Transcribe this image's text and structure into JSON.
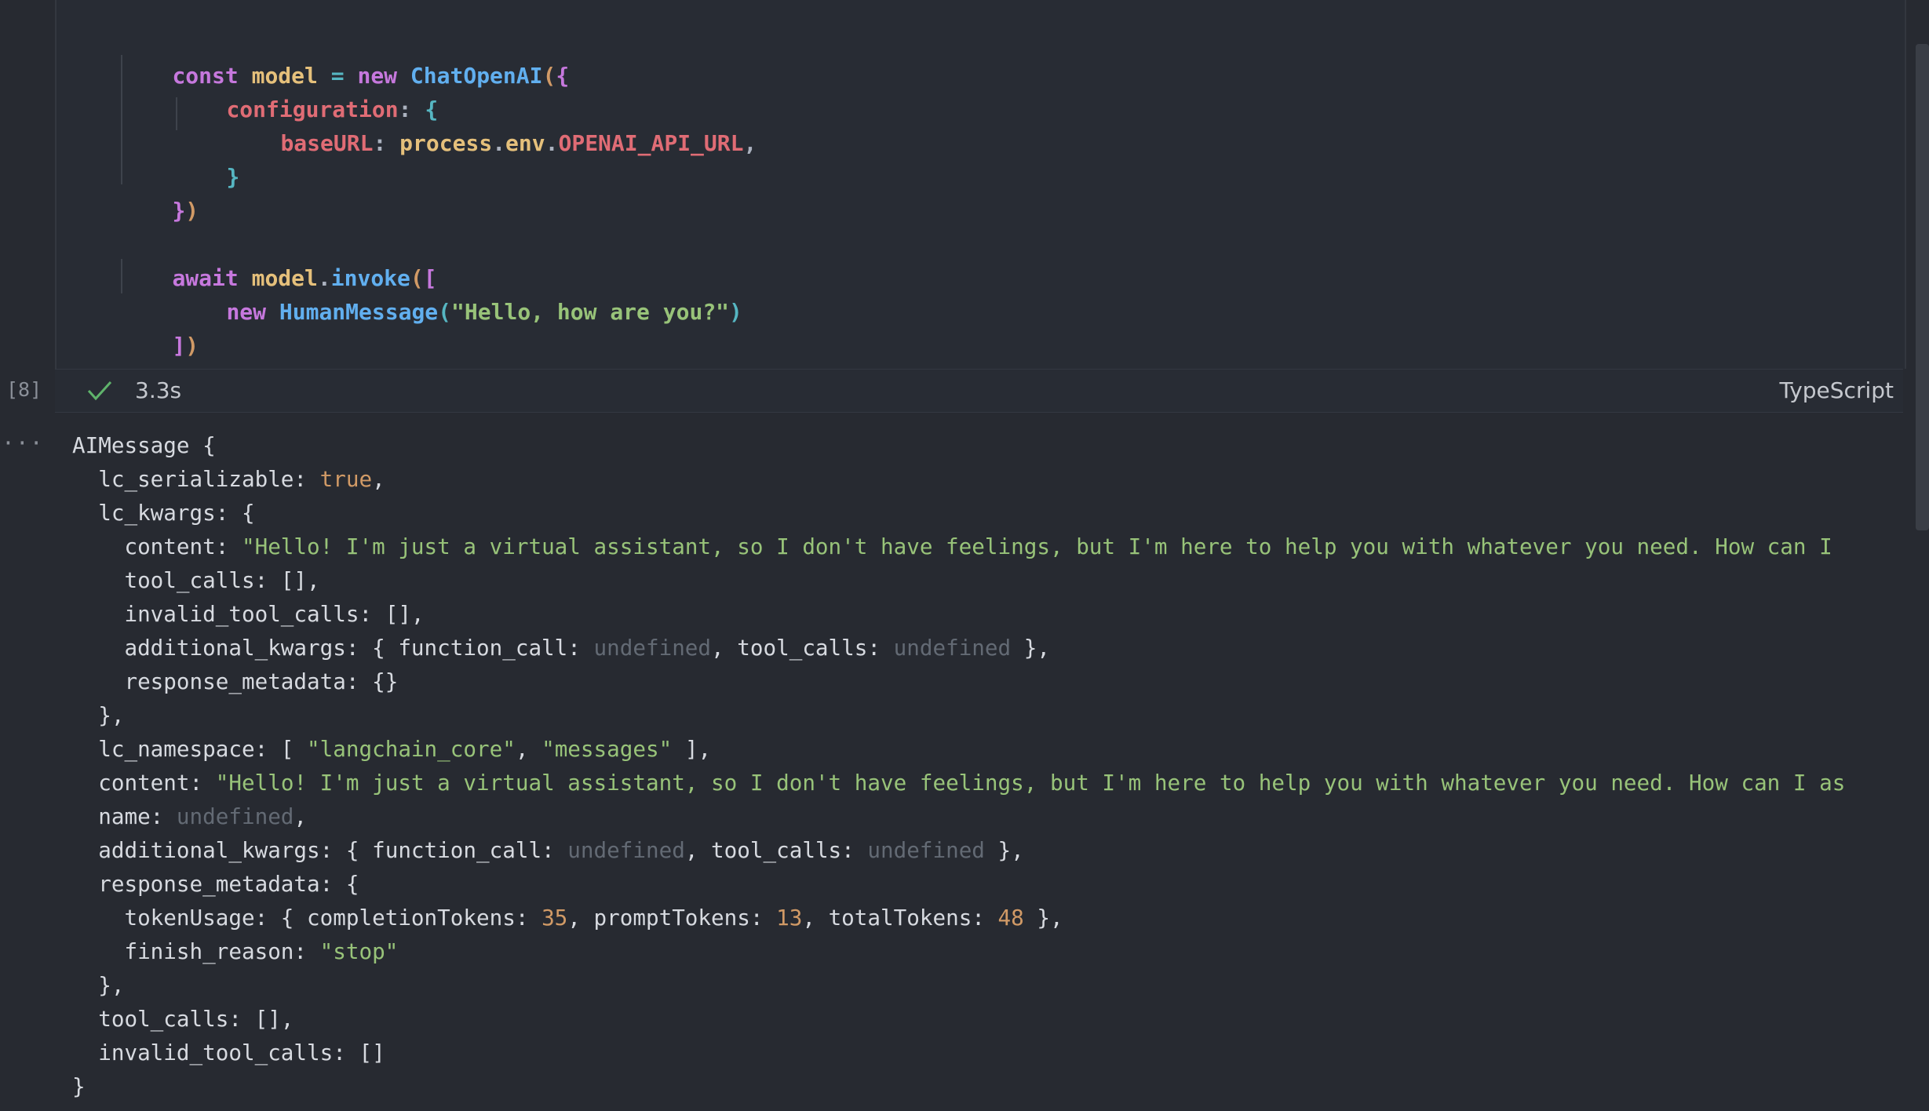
{
  "cell": {
    "execution_count": "[8]",
    "status_icon": "check-icon",
    "duration": "3.3s",
    "language": "TypeScript",
    "output_toggle": "···"
  },
  "code": {
    "l1": {
      "a": "const",
      "b": " ",
      "c": "model",
      "d": " ",
      "e": "=",
      "f": " ",
      "g": "new",
      "h": " ",
      "i": "ChatOpenAI",
      "j": "(",
      "k": "{"
    },
    "l2": {
      "a": "configuration",
      "b": ": ",
      "c": "{"
    },
    "l3": {
      "a": "baseURL",
      "b": ": ",
      "c": "process",
      "d": ".",
      "e": "env",
      "f": ".",
      "g": "OPENAI_API_URL",
      "h": ","
    },
    "l4": {
      "a": "}"
    },
    "l5": {
      "a": "}",
      "b": ")"
    },
    "l6": {
      "a": "await",
      "b": " ",
      "c": "model",
      "d": ".",
      "e": "invoke",
      "f": "(",
      "g": "["
    },
    "l7": {
      "a": "new",
      "b": " ",
      "c": "HumanMessage",
      "d": "(",
      "e": "\"Hello, how are you?\"",
      "f": ")"
    },
    "l8": {
      "a": "]",
      "b": ")"
    }
  },
  "output": {
    "o1": {
      "a": "AIMessage {"
    },
    "o2": {
      "a": "  lc_serializable: ",
      "b": "true",
      "c": ","
    },
    "o3": {
      "a": "  lc_kwargs: {"
    },
    "o4": {
      "a": "    content: ",
      "b": "\"Hello! I'm just a virtual assistant, so I don't have feelings, but I'm here to help you with whatever you need. How can I"
    },
    "o5": {
      "a": "    tool_calls: [],"
    },
    "o6": {
      "a": "    invalid_tool_calls: [],"
    },
    "o7": {
      "a": "    additional_kwargs: { function_call: ",
      "b": "undefined",
      "c": ", tool_calls: ",
      "d": "undefined",
      "e": " },"
    },
    "o8": {
      "a": "    response_metadata: {}"
    },
    "o9": {
      "a": "  },"
    },
    "o10": {
      "a": "  lc_namespace: [ ",
      "b": "\"langchain_core\"",
      "c": ", ",
      "d": "\"messages\"",
      "e": " ],"
    },
    "o11": {
      "a": "  content: ",
      "b": "\"Hello! I'm just a virtual assistant, so I don't have feelings, but I'm here to help you with whatever you need. How can I as"
    },
    "o12": {
      "a": "  name: ",
      "b": "undefined",
      "c": ","
    },
    "o13": {
      "a": "  additional_kwargs: { function_call: ",
      "b": "undefined",
      "c": ", tool_calls: ",
      "d": "undefined",
      "e": " },"
    },
    "o14": {
      "a": "  response_metadata: {"
    },
    "o15": {
      "a": "    tokenUsage: { completionTokens: ",
      "b": "35",
      "c": ", promptTokens: ",
      "d": "13",
      "e": ", totalTokens: ",
      "f": "48",
      "g": " },"
    },
    "o16": {
      "a": "    finish_reason: ",
      "b": "\"stop\""
    },
    "o17": {
      "a": "  },"
    },
    "o18": {
      "a": "  tool_calls: [],"
    },
    "o19": {
      "a": "  invalid_tool_calls: []"
    },
    "o20": {
      "a": "}"
    }
  }
}
